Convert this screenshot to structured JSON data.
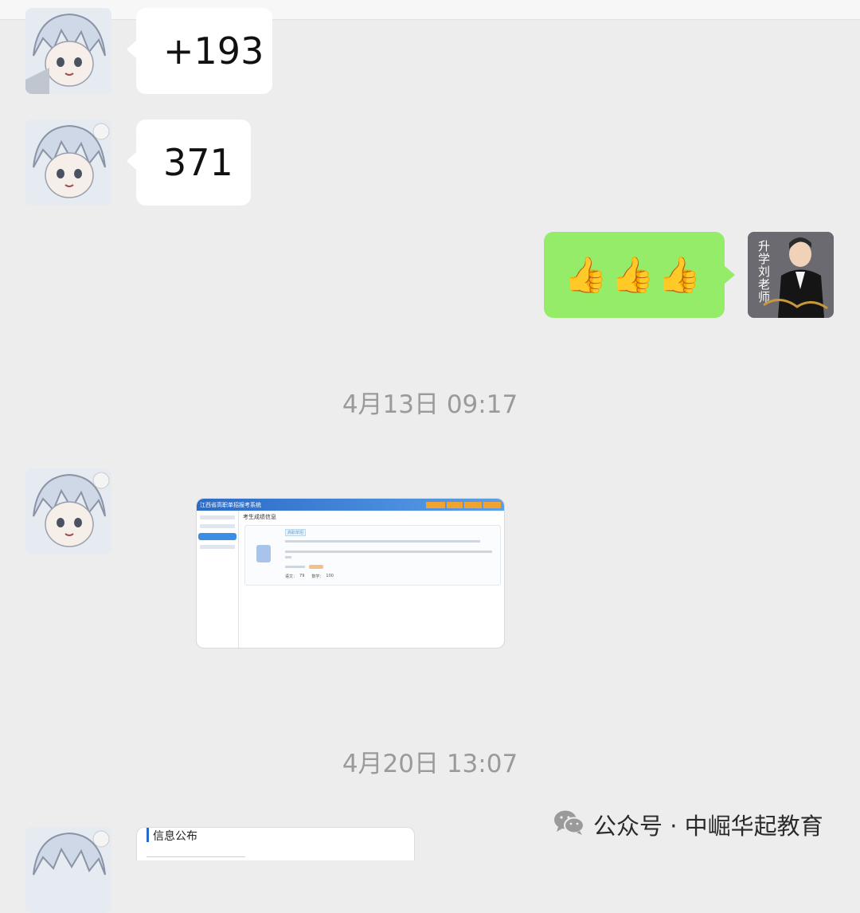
{
  "messages": {
    "m1": {
      "text": "+193"
    },
    "m2": {
      "text": "371"
    },
    "m3": {
      "emoji": "👍👍👍"
    }
  },
  "timestamps": {
    "t1": "4月13日 09:17",
    "t2": "4月20日 13:07"
  },
  "teacher_avatar": {
    "vertical_text": "升学刘老师"
  },
  "score_screenshot": {
    "system_title": "江西省高职单招报考系统",
    "page_heading": "考生成绩信息",
    "tag": "高职单招",
    "field_score_label": "语文：",
    "field_score_value": "79",
    "field_math_label": "数学：",
    "field_math_value": "100"
  },
  "info_card": {
    "title": "信息公布"
  },
  "watermark": {
    "text": "公众号 · 中崛华起教育"
  },
  "colors": {
    "chat_bg": "#ededed",
    "out_bubble": "#95ec69",
    "in_bubble": "#ffffff",
    "timestamp": "#9a9a9a"
  }
}
